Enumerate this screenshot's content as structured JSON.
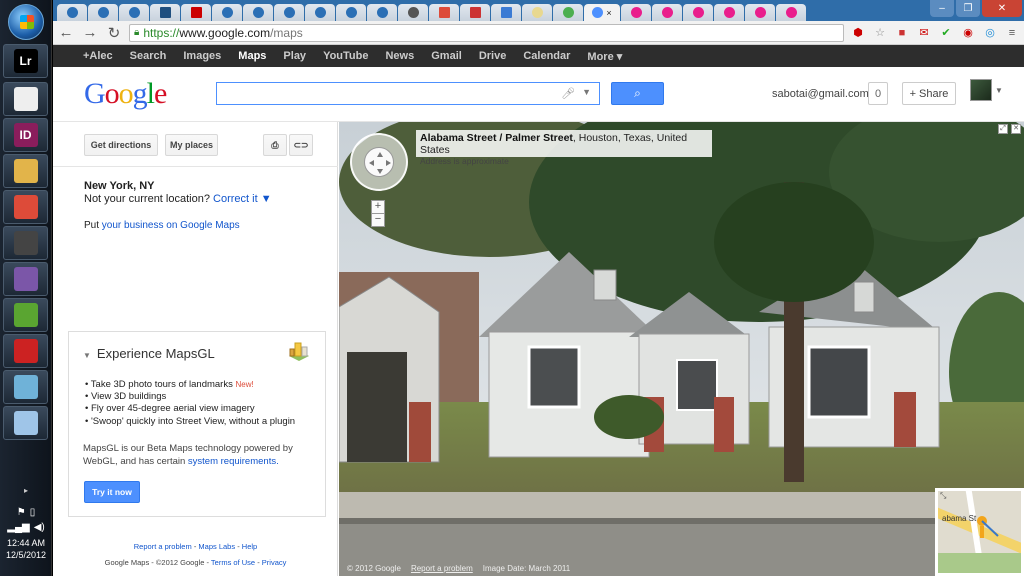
{
  "taskbar": {
    "apps": [
      {
        "label": "Lr",
        "name": "lightroom-icon",
        "color": "#000000"
      },
      {
        "label": "",
        "name": "calendar-app-icon",
        "color": "#eeeeee"
      },
      {
        "label": "ID",
        "name": "indesign-icon",
        "color": "#8a1d5c"
      },
      {
        "label": "",
        "name": "folder-icon",
        "color": "#e2b44a"
      },
      {
        "label": "",
        "name": "chrome-icon",
        "color": "#dd4b39"
      },
      {
        "label": "",
        "name": "foobar-icon",
        "color": "#444444"
      },
      {
        "label": "",
        "name": "pidgin-icon",
        "color": "#7b56a8"
      },
      {
        "label": "",
        "name": "evernote-icon",
        "color": "#5aa531"
      },
      {
        "label": "",
        "name": "red-app-icon",
        "color": "#cc2222"
      },
      {
        "label": "",
        "name": "notes-app-icon",
        "color": "#6fb2d8"
      },
      {
        "label": "",
        "name": "calculator-icon",
        "color": "#9fc5e8"
      }
    ],
    "clock": {
      "time": "12:44 AM",
      "date": "12/5/2012"
    }
  },
  "browser": {
    "url_protocol": "https://",
    "url_host": "www.google.com",
    "url_path": "/maps",
    "tab_close": "×"
  },
  "gbar": {
    "items": [
      "+Alec",
      "Search",
      "Images",
      "Maps",
      "Play",
      "YouTube",
      "News",
      "Gmail",
      "Drive",
      "Calendar",
      "More ▾"
    ],
    "active": "Maps"
  },
  "header": {
    "logo": "Google",
    "account": "sabotai@gmail.com",
    "notifications": "0",
    "share_label": "Share"
  },
  "left_panel": {
    "get_directions": "Get directions",
    "my_places": "My places",
    "location_title": "New York, NY",
    "not_current": "Not your current location?",
    "correct_it": "Correct it ▼",
    "put_prefix": "Put",
    "business_link": "your business on Google Maps",
    "mapsgl": {
      "title": "Experience MapsGL",
      "features": [
        "Take 3D photo tours of landmarks",
        "View 3D buildings",
        "Fly over 45-degree aerial view imagery",
        "'Swoop' quickly into Street View, without a plugin"
      ],
      "new_badge": "New!",
      "desc_prefix": "MapsGL is our Beta Maps technology powered by WebGL, and has certain",
      "desc_link": "system requirements.",
      "try_button": "Try it now"
    },
    "footer": {
      "report": "Report a problem",
      "labs": "Maps Labs",
      "help": "Help",
      "copyright": "Google Maps - ©2012 Google -",
      "terms": "Terms of Use",
      "privacy": "Privacy"
    }
  },
  "street_view": {
    "street": "Alabama Street / Palmer Street",
    "city": ", Houston, Texas, United States",
    "approx": "Address is approximate",
    "copyright": "© 2012 Google",
    "report": "Report a problem",
    "image_date": "Image Date: March 2011",
    "minimap_label": "abama St"
  },
  "colors": {
    "accent_blue": "#4d90fe",
    "link": "#1155cc",
    "gbar": "#2d2d2d",
    "tabstrip": "#2f6da9"
  }
}
